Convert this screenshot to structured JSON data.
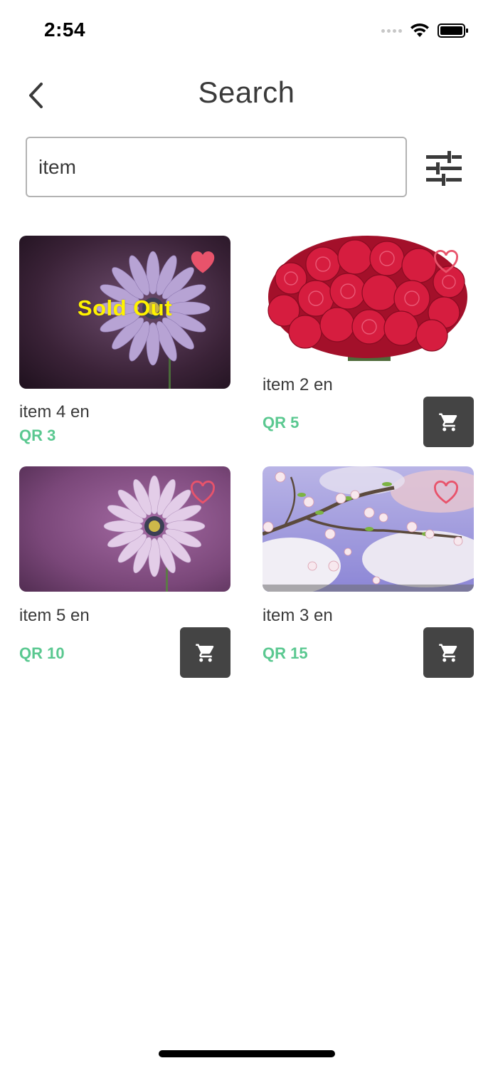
{
  "status_bar": {
    "time": "2:54"
  },
  "header": {
    "title": "Search"
  },
  "search": {
    "value": "item",
    "placeholder": ""
  },
  "products": [
    {
      "name": "item 4 en",
      "price": "QR 3",
      "sold_out_label": "Sold Out",
      "favorited": true,
      "cart_button": false
    },
    {
      "name": "item 2 en",
      "price": "QR 5",
      "favorited": false,
      "cart_button": true
    },
    {
      "name": "item 5 en",
      "price": "QR 10",
      "favorited": false,
      "cart_button": true
    },
    {
      "name": "item 3 en",
      "price": "QR 15",
      "favorited": false,
      "cart_button": true
    }
  ],
  "icons": [
    "back-chevron-icon",
    "filter-sliders-icon",
    "heart-icon",
    "cart-icon",
    "wifi-icon",
    "battery-icon"
  ],
  "colors": {
    "price": "#5ac890",
    "favorite": "#e8536b",
    "sold_out": "#fff200",
    "cart_button": "#444444",
    "text": "#3a3a3a"
  }
}
